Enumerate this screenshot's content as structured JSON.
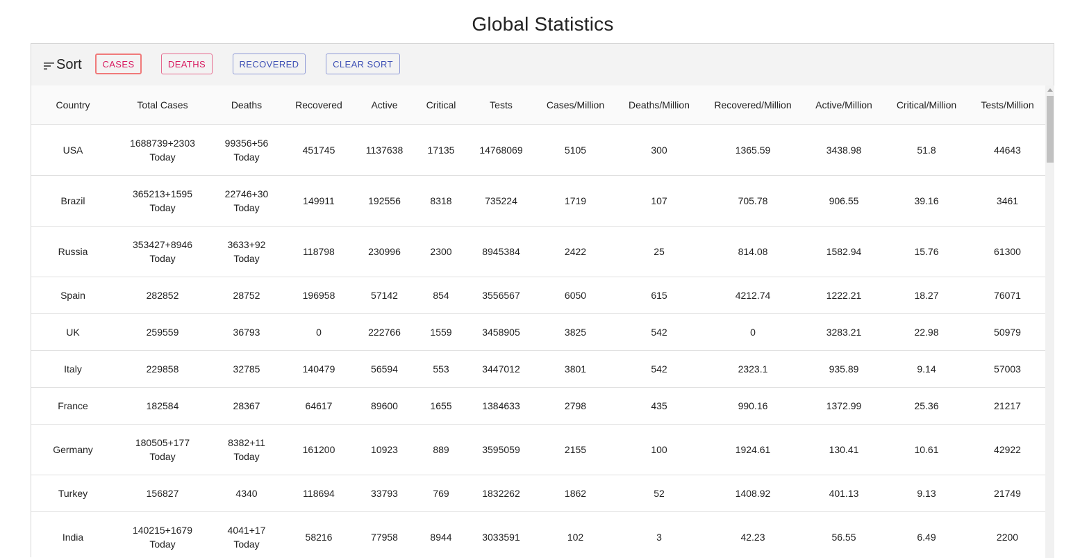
{
  "page": {
    "title": "Global Statistics"
  },
  "sort": {
    "label": "Sort",
    "buttons": [
      "CASES",
      "DEATHS",
      "RECOVERED",
      "CLEAR SORT"
    ]
  },
  "table": {
    "columns": [
      "Country",
      "Total Cases",
      "Deaths",
      "Recovered",
      "Active",
      "Critical",
      "Tests",
      "Cases/Million",
      "Deaths/Million",
      "Recovered/Million",
      "Active/Million",
      "Critical/Million",
      "Tests/Million"
    ],
    "rows": [
      [
        "USA",
        "1688739+2303",
        "99356+56",
        "451745",
        "1137638",
        "17135",
        "14768069",
        "5105",
        "300",
        "1365.59",
        "3438.98",
        "51.8",
        "44643"
      ],
      [
        "Brazil",
        "365213+1595",
        "22746+30",
        "149911",
        "192556",
        "8318",
        "735224",
        "1719",
        "107",
        "705.78",
        "906.55",
        "39.16",
        "3461"
      ],
      [
        "Russia",
        "353427+8946",
        "3633+92",
        "118798",
        "230996",
        "2300",
        "8945384",
        "2422",
        "25",
        "814.08",
        "1582.94",
        "15.76",
        "61300"
      ],
      [
        "Spain",
        "282852",
        "28752",
        "196958",
        "57142",
        "854",
        "3556567",
        "6050",
        "615",
        "4212.74",
        "1222.21",
        "18.27",
        "76071"
      ],
      [
        "UK",
        "259559",
        "36793",
        "0",
        "222766",
        "1559",
        "3458905",
        "3825",
        "542",
        "0",
        "3283.21",
        "22.98",
        "50979"
      ],
      [
        "Italy",
        "229858",
        "32785",
        "140479",
        "56594",
        "553",
        "3447012",
        "3801",
        "542",
        "2323.1",
        "935.89",
        "9.14",
        "57003"
      ],
      [
        "France",
        "182584",
        "28367",
        "64617",
        "89600",
        "1655",
        "1384633",
        "2798",
        "435",
        "990.16",
        "1372.99",
        "25.36",
        "21217"
      ],
      [
        "Germany",
        "180505+177",
        "8382+11",
        "161200",
        "10923",
        "889",
        "3595059",
        "2155",
        "100",
        "1924.61",
        "130.41",
        "10.61",
        "42922"
      ],
      [
        "Turkey",
        "156827",
        "4340",
        "118694",
        "33793",
        "769",
        "1832262",
        "1862",
        "52",
        "1408.92",
        "401.13",
        "9.13",
        "21749"
      ],
      [
        "India",
        "140215+1679",
        "4041+17",
        "58216",
        "77958",
        "8944",
        "3033591",
        "102",
        "3",
        "42.23",
        "56.55",
        "6.49",
        "2200"
      ]
    ],
    "today_label": "Today"
  },
  "colors": {
    "danger": "#d81b60",
    "primary": "#3f51b5"
  },
  "icons": {
    "sort": "sort-lines-icon"
  }
}
